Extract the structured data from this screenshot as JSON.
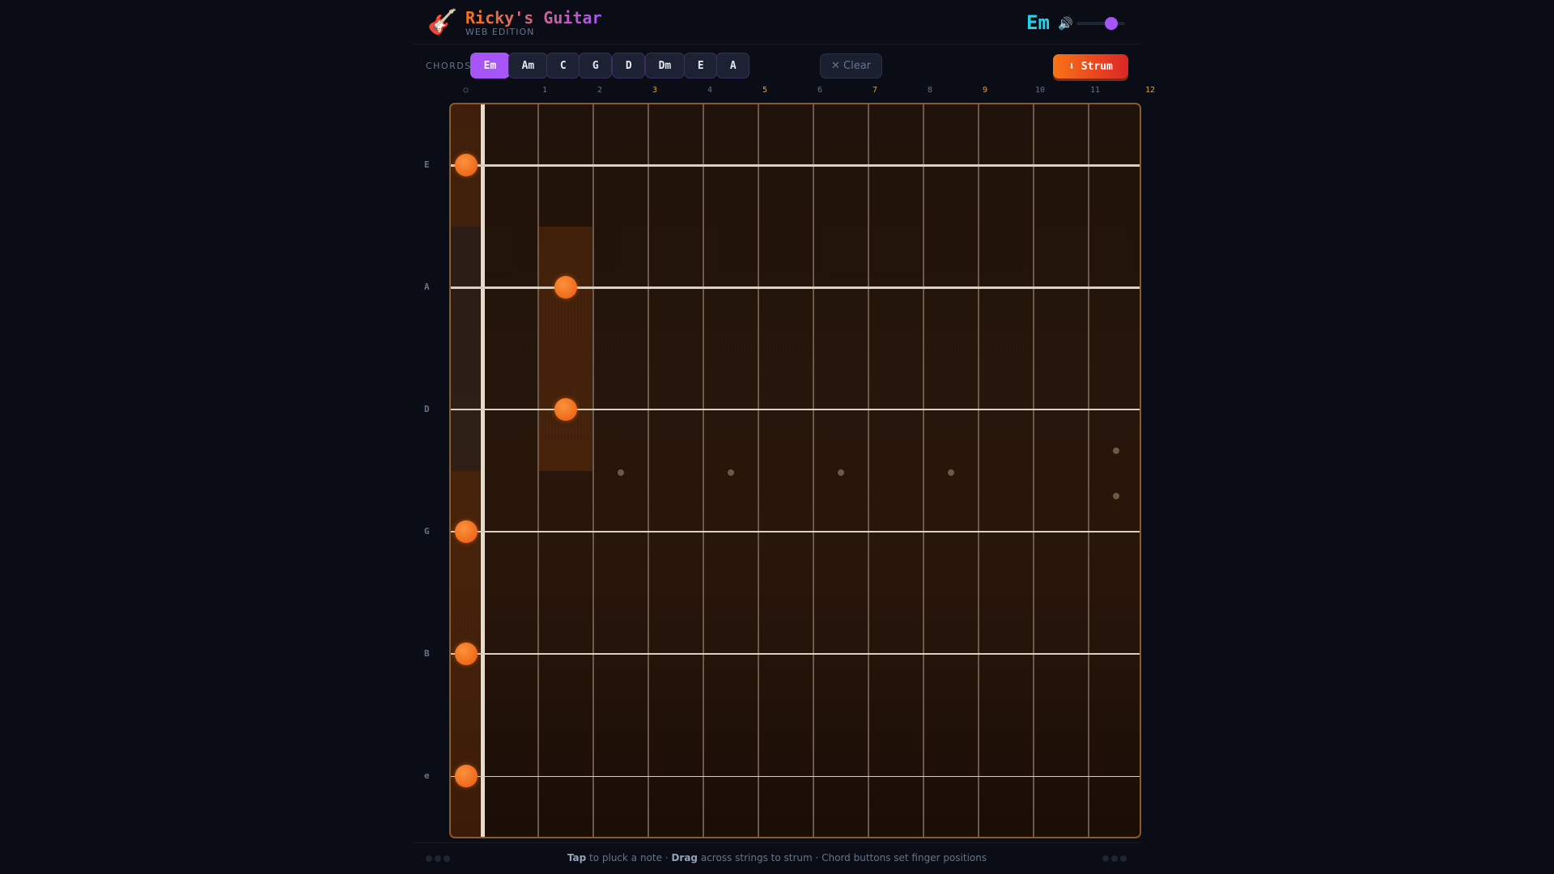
{
  "header": {
    "title": "Ricky's Guitar",
    "subtitle": "WEB EDITION",
    "current_chord": "Em",
    "volume": 0.7,
    "logo_icon": "guitar-icon",
    "volume_icon": "speaker-icon"
  },
  "toolbar": {
    "chords_label": "CHORDS",
    "chords": [
      "Em",
      "Am",
      "C",
      "G",
      "D",
      "Dm",
      "E",
      "A"
    ],
    "active_chord": "Em",
    "clear_label": "✕ Clear",
    "strum_label": "⬇ Strum"
  },
  "fretboard": {
    "open_label": "○",
    "fret_numbers": [
      "1",
      "2",
      "3",
      "4",
      "5",
      "6",
      "7",
      "8",
      "9",
      "10",
      "11",
      "12"
    ],
    "marked_frets": [
      3,
      5,
      7,
      9,
      12
    ],
    "strings": [
      "E",
      "A",
      "D",
      "G",
      "B",
      "e"
    ],
    "fingering": [
      0,
      2,
      2,
      0,
      0,
      0
    ],
    "accent_color": "#f97316"
  },
  "footer": {
    "tap": "Tap",
    "tap_text": " to pluck a note · ",
    "drag": "Drag",
    "drag_text": " across strings to strum · Chord buttons set finger positions"
  }
}
